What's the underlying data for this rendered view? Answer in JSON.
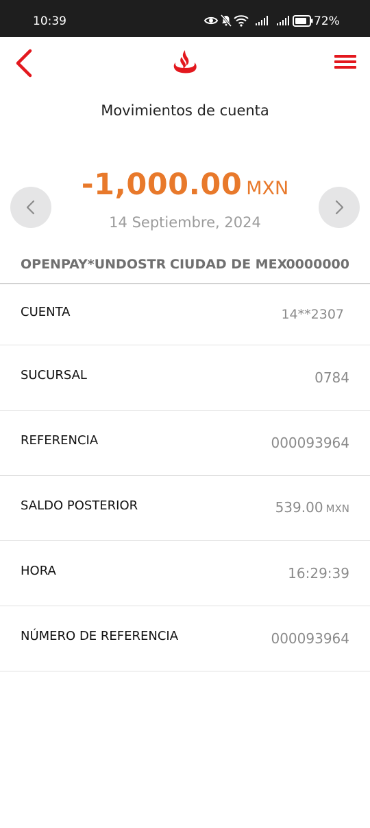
{
  "status_bar": {
    "time": "10:39",
    "battery_percent": "72%",
    "icons": [
      "eye-icon",
      "bell-off-icon",
      "wifi-icon",
      "signal-icon",
      "signal-icon",
      "battery-icon"
    ]
  },
  "header": {
    "back_icon": "chevron-left-icon",
    "logo_icon": "santander-flame-logo",
    "menu_icon": "hamburger-menu-icon"
  },
  "page": {
    "title": "Movimientos de cuenta"
  },
  "transaction": {
    "amount": "-1,000.00",
    "currency": "MXN",
    "date": "14 Septiembre, 2024",
    "merchant_name": "OPENPAY*UNDOSTR",
    "merchant_city": "CIUDAD DE MEX",
    "merchant_code": "0000000"
  },
  "details": [
    {
      "label": "CUENTA",
      "value": "14**2307",
      "unit": ""
    },
    {
      "label": "SUCURSAL",
      "value": "0784",
      "unit": ""
    },
    {
      "label": "REFERENCIA",
      "value": "000093964",
      "unit": ""
    },
    {
      "label": "SALDO POSTERIOR",
      "value": "539.00",
      "unit": "MXN"
    },
    {
      "label": "HORA",
      "value": "16:29:39",
      "unit": ""
    },
    {
      "label": "NÚMERO DE REFERENCIA",
      "value": "000093964",
      "unit": ""
    }
  ],
  "colors": {
    "brand_red": "#e3181e",
    "amount_orange": "#e8792b",
    "status_bar_bg": "#1e1e1e"
  }
}
